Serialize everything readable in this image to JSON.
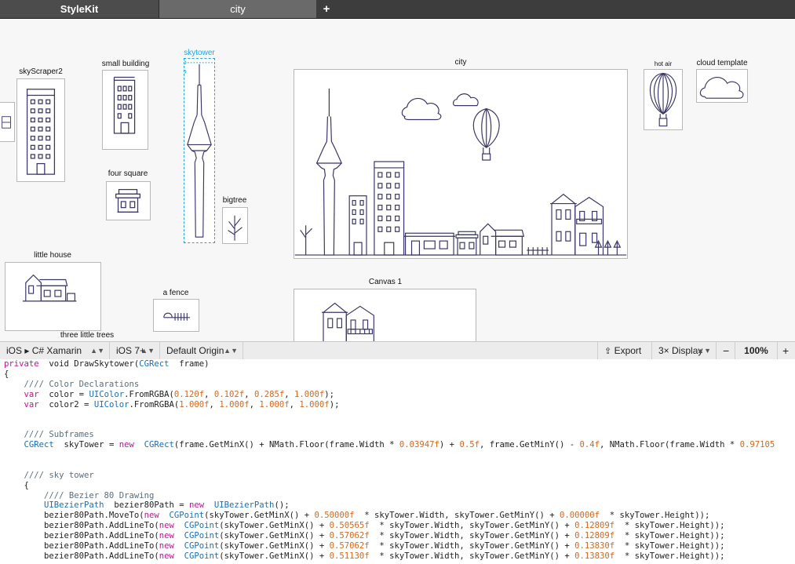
{
  "tabs": {
    "app": "StyleKit",
    "doc": "city",
    "add": "+"
  },
  "frames": {
    "skyscraper2": "skyScraper2",
    "small_building": "small building",
    "skytower": "skytower",
    "four_square": "four square",
    "bigtree": "bigtree",
    "city": "city",
    "hot_air": "hot air",
    "cloud_template": "cloud template",
    "little_house": "little house",
    "a_fence": "a fence",
    "three_little_trees": "three little trees",
    "canvas1": "Canvas 1"
  },
  "toolbar": {
    "platform": "iOS ▸ C# Xamarin",
    "version": "iOS 7+",
    "origin": "Default Origin",
    "export": "Export",
    "display": "3× Display",
    "zoom_out": "−",
    "zoom": "100%",
    "zoom_in": "+"
  },
  "colors": {
    "stroke": "#3a3566",
    "accent": "#1fa8e0"
  },
  "code": [
    [
      [
        "kw",
        "private"
      ],
      [
        "",
        "  void DrawSkytower("
      ],
      [
        "ty",
        "CGRect"
      ],
      [
        "",
        "  frame)"
      ]
    ],
    [
      [
        "",
        "{"
      ]
    ],
    [
      [
        "cm",
        "    //// Color Declarations"
      ]
    ],
    [
      [
        "kw",
        "    var"
      ],
      [
        "",
        "  color = "
      ],
      [
        "ty",
        "UIColor"
      ],
      [
        "",
        ".FromRGBA("
      ],
      [
        "nm",
        "0.120f"
      ],
      [
        "",
        ", "
      ],
      [
        "nm",
        "0.102f"
      ],
      [
        "",
        ", "
      ],
      [
        "nm",
        "0.285f"
      ],
      [
        "",
        ", "
      ],
      [
        "nm",
        "1.000f"
      ],
      [
        "",
        ");"
      ]
    ],
    [
      [
        "kw",
        "    var"
      ],
      [
        "",
        "  color2 = "
      ],
      [
        "ty",
        "UIColor"
      ],
      [
        "",
        ".FromRGBA("
      ],
      [
        "nm",
        "1.000f"
      ],
      [
        "",
        ", "
      ],
      [
        "nm",
        "1.000f"
      ],
      [
        "",
        ", "
      ],
      [
        "nm",
        "1.000f"
      ],
      [
        "",
        ", "
      ],
      [
        "nm",
        "1.000f"
      ],
      [
        "",
        ");"
      ]
    ],
    [
      [
        "",
        ""
      ]
    ],
    [
      [
        "",
        ""
      ]
    ],
    [
      [
        "cm",
        "    //// Subframes"
      ]
    ],
    [
      [
        "ty",
        "    CGRect"
      ],
      [
        "",
        "  skyTower = "
      ],
      [
        "kw",
        "new"
      ],
      [
        "ty",
        "  CGRect"
      ],
      [
        "",
        "(frame.GetMinX() + NMath.Floor(frame.Width * "
      ],
      [
        "nm",
        "0.03947f"
      ],
      [
        "",
        ") + "
      ],
      [
        "nm",
        "0.5f"
      ],
      [
        "",
        ", frame.GetMinY() - "
      ],
      [
        "nm",
        "0.4f"
      ],
      [
        "",
        ", NMath.Floor(frame.Width * "
      ],
      [
        "nm",
        "0.97105"
      ]
    ],
    [
      [
        "",
        ""
      ]
    ],
    [
      [
        "",
        ""
      ]
    ],
    [
      [
        "cm",
        "    //// sky tower"
      ]
    ],
    [
      [
        "",
        "    {"
      ]
    ],
    [
      [
        "cm",
        "        //// Bezier 80 Drawing"
      ]
    ],
    [
      [
        "ty",
        "        UIBezierPath"
      ],
      [
        "",
        "  bezier80Path = "
      ],
      [
        "kw",
        "new"
      ],
      [
        "ty",
        "  UIBezierPath"
      ],
      [
        "",
        "();"
      ]
    ],
    [
      [
        "",
        "        bezier80Path.MoveTo("
      ],
      [
        "kw",
        "new"
      ],
      [
        "ty",
        "  CGPoint"
      ],
      [
        "",
        "(skyTower.GetMinX() + "
      ],
      [
        "nm",
        "0.50000f"
      ],
      [
        "",
        "  * skyTower.Width, skyTower.GetMinY() + "
      ],
      [
        "nm",
        "0.00000f"
      ],
      [
        "",
        "  * skyTower.Height));"
      ]
    ],
    [
      [
        "",
        "        bezier80Path.AddLineTo("
      ],
      [
        "kw",
        "new"
      ],
      [
        "ty",
        "  CGPoint"
      ],
      [
        "",
        "(skyTower.GetMinX() + "
      ],
      [
        "nm",
        "0.50565f"
      ],
      [
        "",
        "  * skyTower.Width, skyTower.GetMinY() + "
      ],
      [
        "nm",
        "0.12809f"
      ],
      [
        "",
        "  * skyTower.Height));"
      ]
    ],
    [
      [
        "",
        "        bezier80Path.AddLineTo("
      ],
      [
        "kw",
        "new"
      ],
      [
        "ty",
        "  CGPoint"
      ],
      [
        "",
        "(skyTower.GetMinX() + "
      ],
      [
        "nm",
        "0.57062f"
      ],
      [
        "",
        "  * skyTower.Width, skyTower.GetMinY() + "
      ],
      [
        "nm",
        "0.12809f"
      ],
      [
        "",
        "  * skyTower.Height));"
      ]
    ],
    [
      [
        "",
        "        bezier80Path.AddLineTo("
      ],
      [
        "kw",
        "new"
      ],
      [
        "ty",
        "  CGPoint"
      ],
      [
        "",
        "(skyTower.GetMinX() + "
      ],
      [
        "nm",
        "0.57062f"
      ],
      [
        "",
        "  * skyTower.Width, skyTower.GetMinY() + "
      ],
      [
        "nm",
        "0.13830f"
      ],
      [
        "",
        "  * skyTower.Height));"
      ]
    ],
    [
      [
        "",
        "        bezier80Path.AddLineTo("
      ],
      [
        "kw",
        "new"
      ],
      [
        "ty",
        "  CGPoint"
      ],
      [
        "",
        "(skyTower.GetMinX() + "
      ],
      [
        "nm",
        "0.51130f"
      ],
      [
        "",
        "  * skyTower.Width, skyTower.GetMinY() + "
      ],
      [
        "nm",
        "0.13830f"
      ],
      [
        "",
        "  * skyTower.Height));"
      ]
    ]
  ]
}
